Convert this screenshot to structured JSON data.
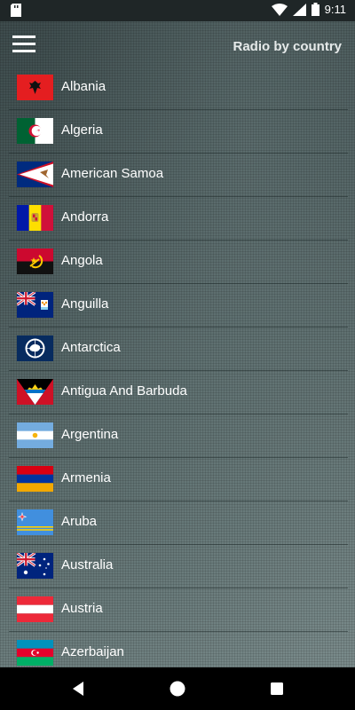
{
  "status_bar": {
    "time": "9:11"
  },
  "header": {
    "title": "Radio by country"
  },
  "countries": [
    {
      "label": "Albania",
      "flag_icon": "albania-flag-icon"
    },
    {
      "label": "Algeria",
      "flag_icon": "algeria-flag-icon"
    },
    {
      "label": "American Samoa",
      "flag_icon": "american-samoa-flag-icon"
    },
    {
      "label": "Andorra",
      "flag_icon": "andorra-flag-icon"
    },
    {
      "label": "Angola",
      "flag_icon": "angola-flag-icon"
    },
    {
      "label": "Anguilla",
      "flag_icon": "anguilla-flag-icon"
    },
    {
      "label": "Antarctica",
      "flag_icon": "antarctica-flag-icon"
    },
    {
      "label": "Antigua And Barbuda",
      "flag_icon": "antigua-and-barbuda-flag-icon"
    },
    {
      "label": "Argentina",
      "flag_icon": "argentina-flag-icon"
    },
    {
      "label": "Armenia",
      "flag_icon": "armenia-flag-icon"
    },
    {
      "label": "Aruba",
      "flag_icon": "aruba-flag-icon"
    },
    {
      "label": "Australia",
      "flag_icon": "australia-flag-icon"
    },
    {
      "label": "Austria",
      "flag_icon": "austria-flag-icon"
    },
    {
      "label": "Azerbaijan",
      "flag_icon": "azerbaijan-flag-icon"
    }
  ],
  "colors": {
    "accent_text": "#ffffff",
    "status_bar": "#1f2627",
    "nav_bar": "#000000"
  }
}
